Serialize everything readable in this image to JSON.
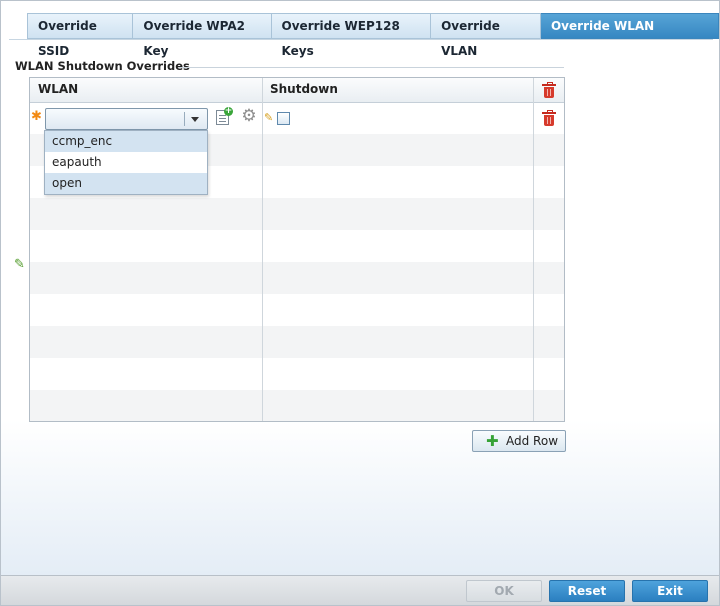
{
  "tabs": [
    {
      "label": "Override SSID",
      "active": false
    },
    {
      "label": "Override WPA2 Key",
      "active": false
    },
    {
      "label": "Override WEP128 Keys",
      "active": false
    },
    {
      "label": "Override VLAN",
      "active": false
    },
    {
      "label": "Override WLAN Shutdown",
      "active": true
    }
  ],
  "section": {
    "title": "WLAN Shutdown Overrides"
  },
  "table": {
    "columns": {
      "wlan": "WLAN",
      "shutdown": "Shutdown"
    },
    "row": {
      "wlan_value": "",
      "shutdown_checked": false
    },
    "dropdown_options": [
      "ccmp_enc",
      "eapauth",
      "open"
    ],
    "highlighted_options": [
      "ccmp_enc",
      "open"
    ]
  },
  "add_row": {
    "label": "Add Row"
  },
  "footer": {
    "ok": "OK",
    "reset": "Reset",
    "exit": "Exit"
  },
  "icons": {
    "required": "asterisk-icon",
    "create_new": "create-new-icon",
    "configure": "gear-icon",
    "delete": "trash-icon",
    "edit": "pencil-icon",
    "add": "plus-icon"
  },
  "colors": {
    "accent": "#3a8ac4",
    "delete": "#d63a2c",
    "required": "#f28a14",
    "add": "#36a236"
  }
}
